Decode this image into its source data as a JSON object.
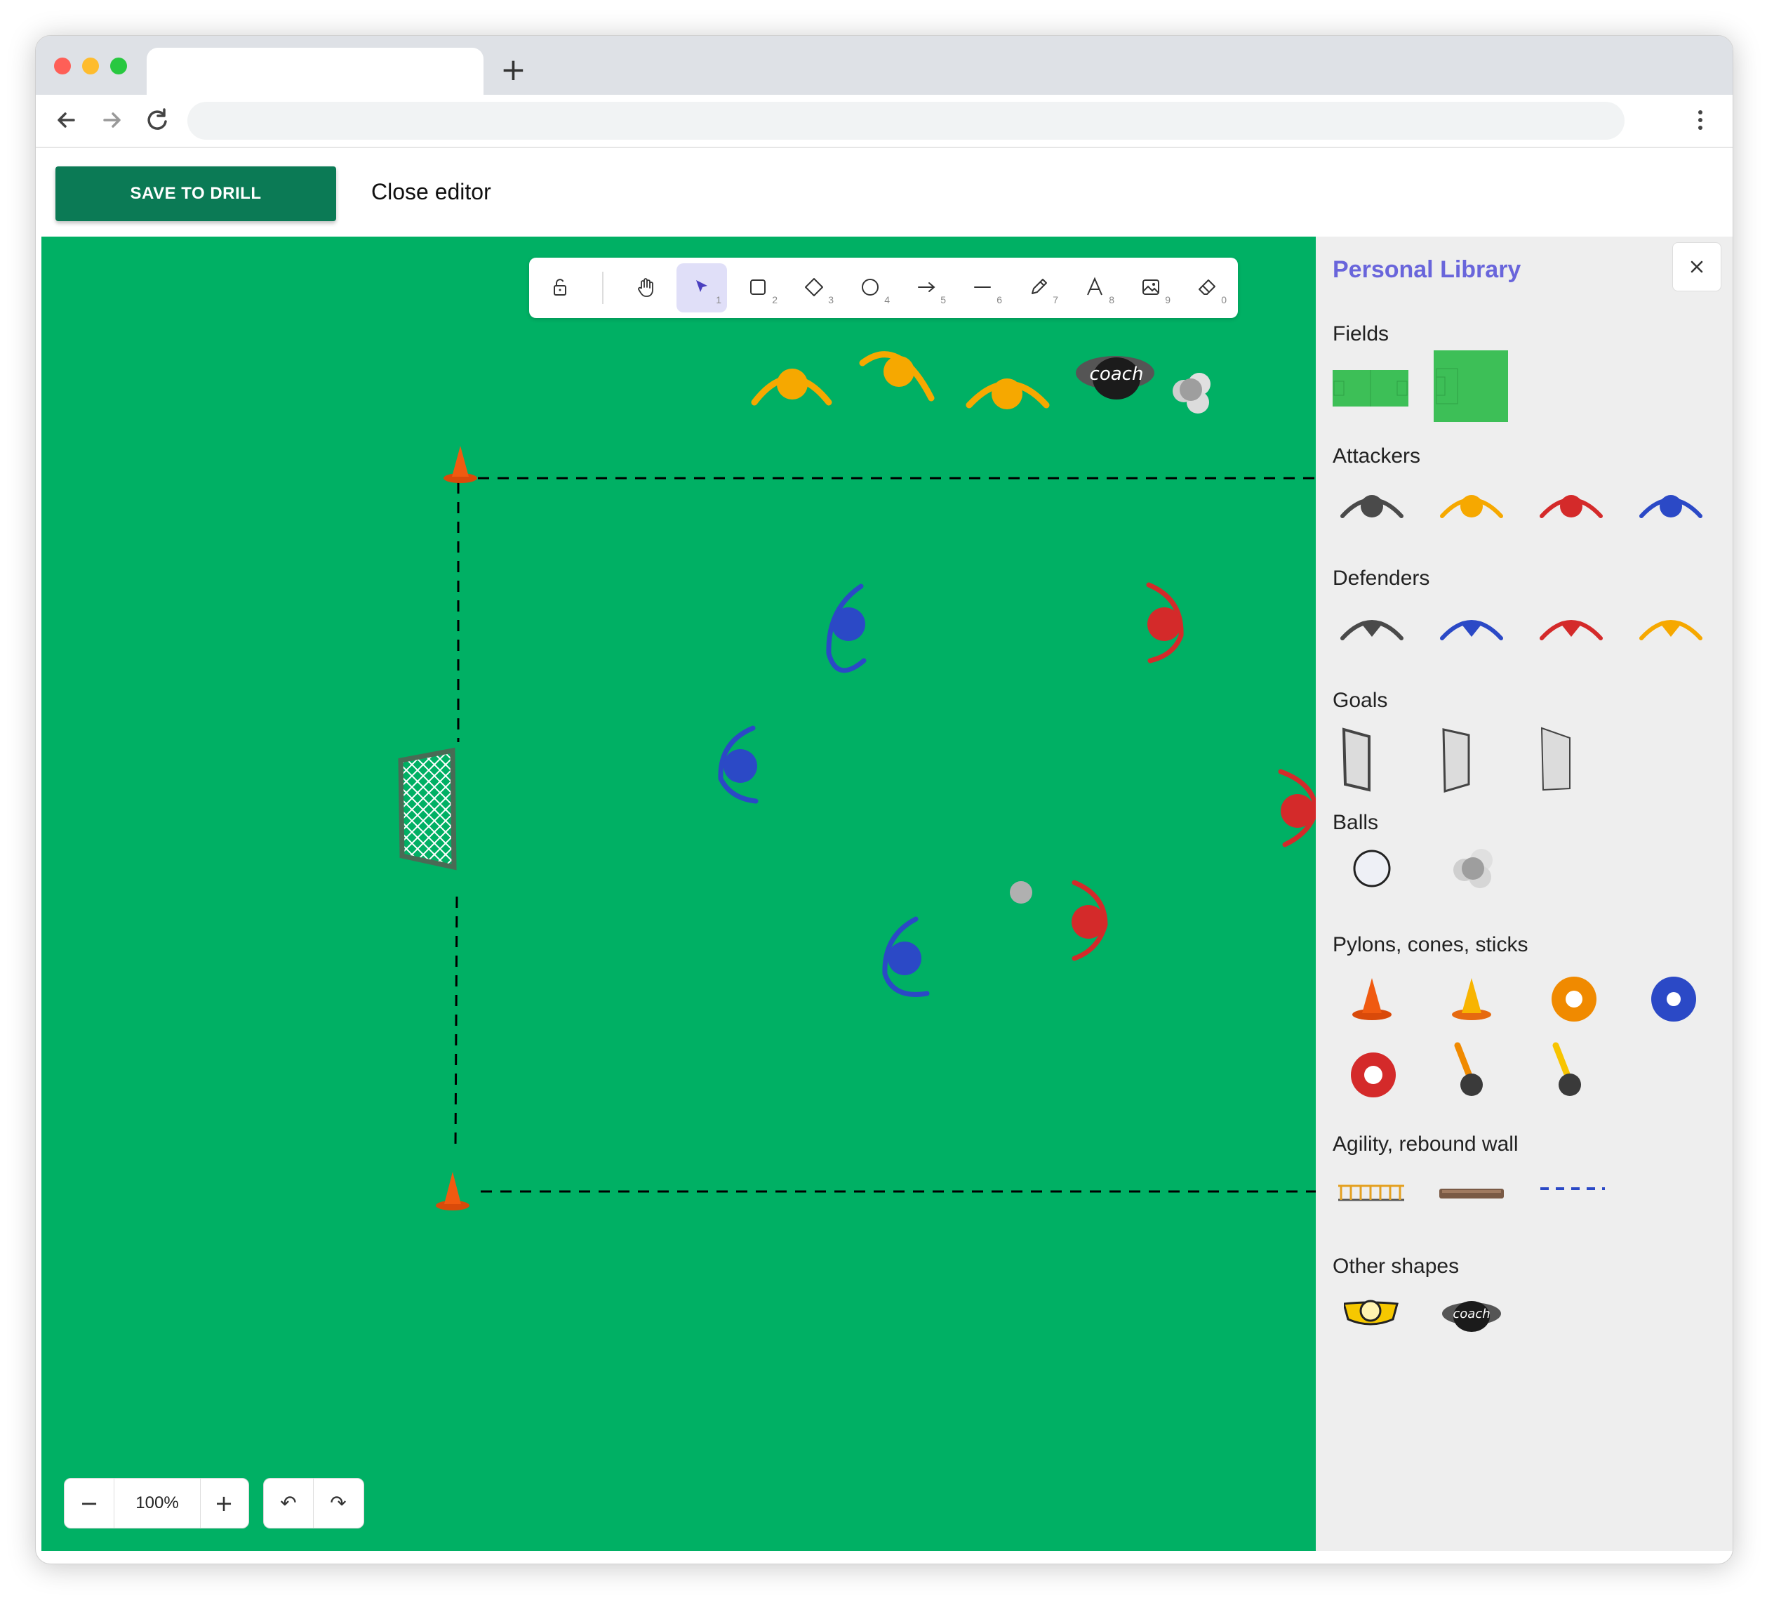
{
  "browser": {
    "tab_title": "",
    "new_tab_label": "+",
    "address": ""
  },
  "appbar": {
    "save_label": "SAVE TO DRILL",
    "close_label": "Close editor"
  },
  "toolbar": {
    "tools": [
      {
        "name": "lock",
        "key": ""
      },
      {
        "name": "hand",
        "key": ""
      },
      {
        "name": "selection",
        "key": "1",
        "active": true
      },
      {
        "name": "rectangle",
        "key": "2"
      },
      {
        "name": "diamond",
        "key": "3"
      },
      {
        "name": "ellipse",
        "key": "4"
      },
      {
        "name": "arrow",
        "key": "5"
      },
      {
        "name": "line",
        "key": "6"
      },
      {
        "name": "draw",
        "key": "7"
      },
      {
        "name": "text",
        "key": "8"
      },
      {
        "name": "image",
        "key": "9"
      },
      {
        "name": "eraser",
        "key": "0"
      }
    ]
  },
  "zoom": {
    "minus": "−",
    "value": "100%",
    "plus": "+"
  },
  "history": {
    "undo": "↶",
    "redo": "↷"
  },
  "canvas": {
    "coach_label": "coach",
    "background": "#00b064"
  },
  "library": {
    "title": "Personal Library",
    "sections": {
      "fields": "Fields",
      "attackers": "Attackers",
      "defenders": "Defenders",
      "goals": "Goals",
      "balls": "Balls",
      "cones": "Pylons, cones, sticks",
      "agility": "Agility, rebound wall",
      "other": "Other shapes"
    },
    "coach_label": "coach"
  },
  "colors": {
    "accent": "#6965db",
    "save_button": "#0b7a55",
    "team_yellow": "#f6a800",
    "team_blue": "#2b49c6",
    "team_red": "#d42a2a",
    "team_grey": "#4a4a4a",
    "cone_orange": "#f05a10"
  }
}
